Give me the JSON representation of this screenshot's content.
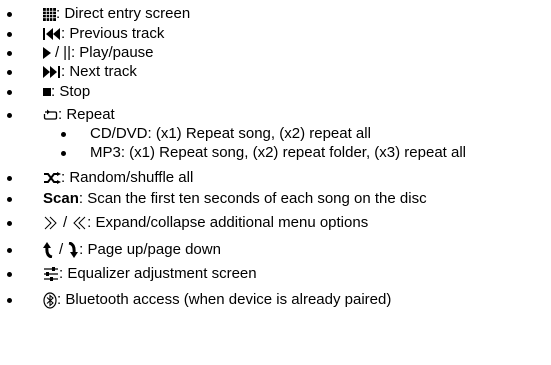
{
  "items": [
    {
      "text": ": Direct entry screen"
    },
    {
      "text": ": Previous track"
    },
    {
      "sep": "/",
      "pause_glyph": "||",
      "text": ": Play/pause"
    },
    {
      "text": ": Next track"
    },
    {
      "text": ": Stop"
    },
    {
      "text": ": Repeat"
    },
    {
      "text": "CD/DVD: (x1) Repeat song, (x2) repeat all"
    },
    {
      "text": "MP3: (x1) Repeat song, (x2) repeat folder, (x3) repeat all"
    },
    {
      "text": ": Random/shuffle all"
    },
    {
      "bold": "Scan",
      "text": ": Scan the first ten seconds of each song on the disc"
    },
    {
      "sep": "/",
      "text": ": Expand/collapse additional menu options"
    },
    {
      "sep": "/",
      "text": ": Page up/page down"
    },
    {
      "text": ": Equalizer adjustment screen"
    },
    {
      "text": ": Bluetooth access (when device is already paired)"
    }
  ],
  "icons": {
    "grid": "keypad-grid-icon",
    "prev": "previous-track-icon",
    "play": "play-icon",
    "next": "next-track-icon",
    "stop": "stop-icon",
    "repeat": "repeat-icon",
    "shuffle": "shuffle-icon",
    "expand": "expand-chevrons-icon",
    "collapse": "collapse-chevrons-icon",
    "page_up": "page-up-arrow-icon",
    "page_down": "page-down-arrow-icon",
    "equalizer": "equalizer-icon",
    "bluetooth": "bluetooth-icon"
  }
}
